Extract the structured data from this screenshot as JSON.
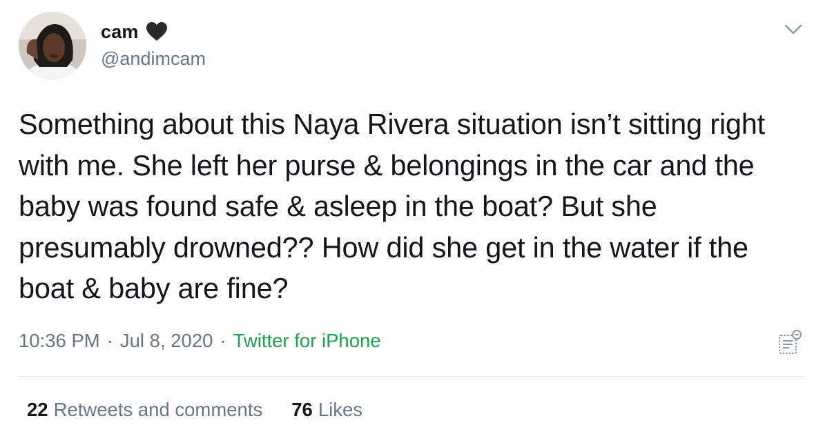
{
  "author": {
    "display_name": "cam",
    "handle": "@andimcam",
    "badge_icon": "black-heart-icon"
  },
  "tweet": {
    "text": "Something about this Naya Rivera situation isn’t sitting right with me. She left her purse & belongings in the car and the baby was found safe & asleep in the boat? But she presumably drowned?? How did she get in the water if the boat & baby are fine?"
  },
  "meta": {
    "time": "10:36 PM",
    "separator": "·",
    "date": "Jul 8, 2020",
    "source": "Twitter for iPhone"
  },
  "stats": {
    "retweets_count": "22",
    "retweets_label": "Retweets and comments",
    "likes_count": "76",
    "likes_label": "Likes"
  },
  "colors": {
    "text": "#14171a",
    "secondary": "#657786",
    "source_link": "#1aa34a",
    "divider": "#e1e8ed"
  },
  "icons": {
    "menu": "chevron-down-icon",
    "analytics": "analytics-icon"
  }
}
